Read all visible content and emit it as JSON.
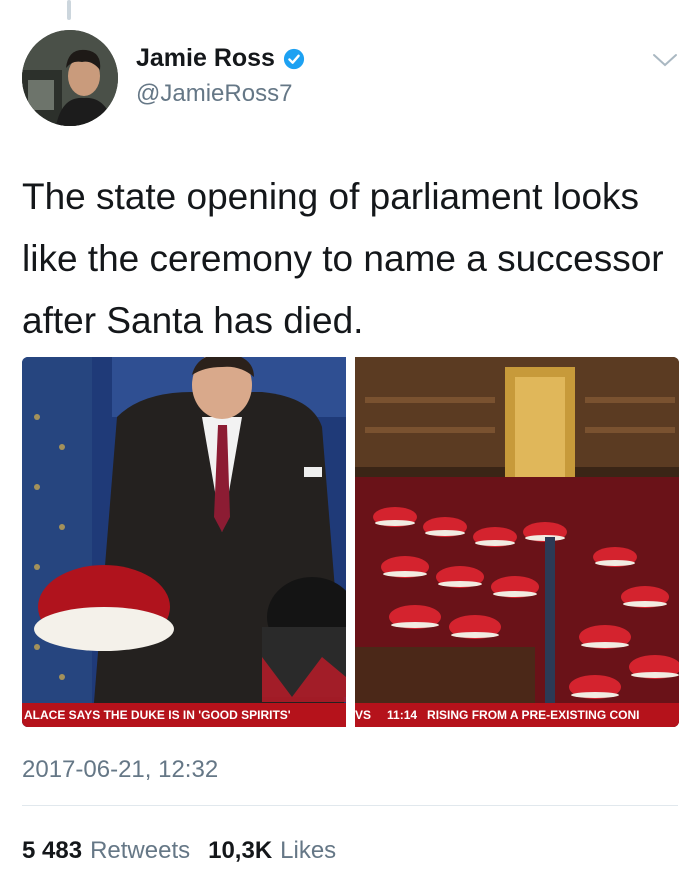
{
  "tweet": {
    "display_name": "Jamie Ross",
    "handle": "@JamieRoss7",
    "verified": true,
    "text": "The state opening of parliament looks like the ceremony to name a successor after Santa has died.",
    "timestamp": "2017-06-21, 12:32"
  },
  "media": {
    "left_ticker": "ALACE SAYS THE DUKE IS IN 'GOOD SPIRITS'",
    "right_ticker_prefix": "VS",
    "right_ticker_time": "11:14",
    "right_ticker_text": "RISING FROM A PRE-EXISTING CONI"
  },
  "stats": {
    "retweets_count": "5 483",
    "retweets_label": "Retweets",
    "likes_count": "10,3K",
    "likes_label": "Likes"
  },
  "colors": {
    "text": "#14171a",
    "secondary": "#657786",
    "verified_blue": "#1da1f2",
    "ticker_red": "#b5121b"
  },
  "icons": [
    "verified-badge-icon",
    "chevron-down-icon"
  ]
}
